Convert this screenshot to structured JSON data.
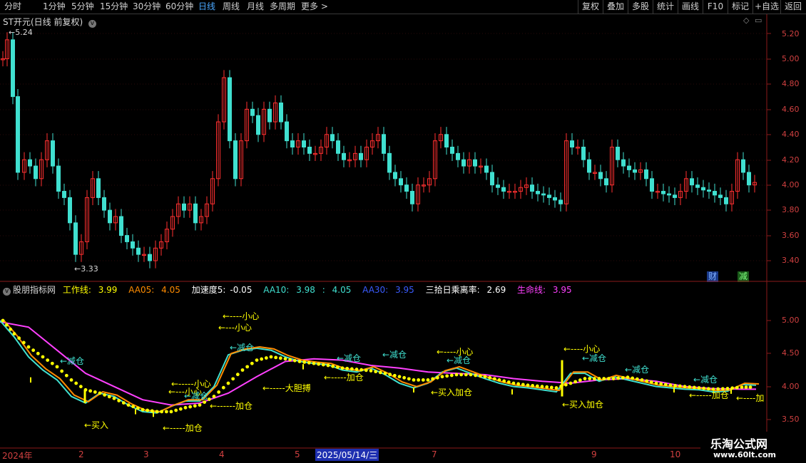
{
  "toolbar": {
    "periods": [
      "分时",
      "1分钟",
      "5分钟",
      "15分钟",
      "30分钟",
      "60分钟",
      "日线",
      "周线",
      "月线",
      "多周期",
      "更多 >"
    ],
    "active_period": "日线",
    "right_buttons": [
      "复权",
      "叠加",
      "多股",
      "统计",
      "画线",
      "F10",
      "标记",
      "+自选",
      "返回"
    ]
  },
  "main_chart": {
    "title": "ST开元(日线 前复权)",
    "high_label": "5.24",
    "low_label": "3.33",
    "y_ticks": [
      "5.20",
      "5.00",
      "4.80",
      "4.60",
      "4.40",
      "4.20",
      "4.00",
      "3.80",
      "3.60",
      "3.40"
    ],
    "badges": {
      "cai": "财",
      "jian": "减"
    }
  },
  "indicator": {
    "name": "股朋指标网",
    "items": [
      {
        "label": "工作线:",
        "value": "3.99",
        "color": "#ffff00"
      },
      {
        "label": "AA05:",
        "value": "4.05",
        "color": "#ff8c00"
      },
      {
        "label": "加速度5:",
        "value": "-0.05",
        "color": "#ffffff"
      },
      {
        "label": "AA10:",
        "value": "3.98",
        "color": "#40e0d0"
      },
      {
        "label": ":",
        "value": "4.05",
        "color": "#40e0d0"
      },
      {
        "label": "AA30:",
        "value": "3.95",
        "color": "#3a5cff"
      },
      {
        "label": "三拾日乘离率:",
        "value": "2.69",
        "color": "#ffffff"
      },
      {
        "label": "生命线:",
        "value": "3.95",
        "color": "#ff40ff"
      }
    ],
    "y_ticks": [
      "5.00",
      "4.50",
      "4.00",
      "3.50"
    ],
    "annotations": [
      {
        "text": "←减仓",
        "color": "#40e0d0"
      },
      {
        "text": "←买入",
        "color": "#ffff00"
      },
      {
        "text": "←-----加仓",
        "color": "#ffff00"
      },
      {
        "text": "←-----小心",
        "color": "#ffff00"
      },
      {
        "text": "←---小心",
        "color": "#ffff00"
      },
      {
        "text": "←减仓",
        "color": "#40e0d0"
      },
      {
        "text": "←------加仓",
        "color": "#ffff00"
      },
      {
        "text": "←----小心",
        "color": "#ffff00"
      },
      {
        "text": "←---小心",
        "color": "#ffff00"
      },
      {
        "text": "←减仓",
        "color": "#40e0d0"
      },
      {
        "text": "←-----大胆搏",
        "color": "#ffff00"
      },
      {
        "text": "←减仓",
        "color": "#40e0d0"
      },
      {
        "text": "←-----加仓",
        "color": "#ffff00"
      },
      {
        "text": "←减仓",
        "color": "#40e0d0"
      },
      {
        "text": "←----小心",
        "color": "#ffff00"
      },
      {
        "text": "←减仓",
        "color": "#40e0d0"
      },
      {
        "text": "←买入加仓",
        "color": "#ffff00"
      },
      {
        "text": "←----小心",
        "color": "#ffff00"
      },
      {
        "text": "←减仓",
        "color": "#40e0d0"
      },
      {
        "text": "←买入加仓",
        "color": "#ffff00"
      },
      {
        "text": "←减仓",
        "color": "#40e0d0"
      },
      {
        "text": "←减仓",
        "color": "#40e0d0"
      },
      {
        "text": "←-----加仓",
        "color": "#ffff00"
      },
      {
        "text": "←----加",
        "color": "#ffff00"
      }
    ]
  },
  "time_axis": {
    "labels": [
      "2024年",
      "2",
      "3",
      "4",
      "5",
      "7",
      "9",
      "10"
    ],
    "cursor_date": "2025/05/14/三"
  },
  "watermark": {
    "line1": "乐淘公式网",
    "line2": "www.60lt.com"
  }
}
